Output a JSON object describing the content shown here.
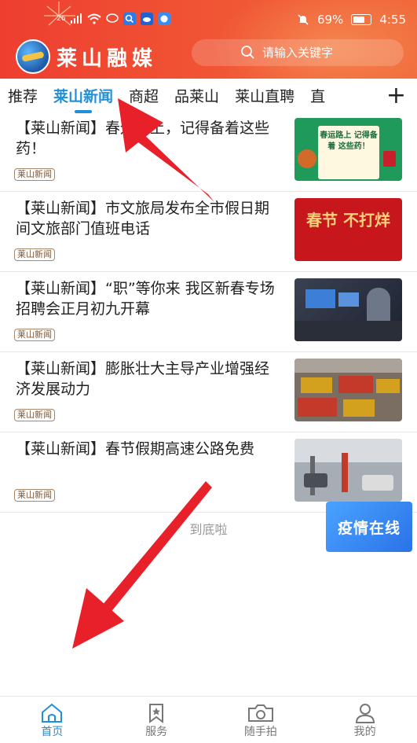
{
  "status": {
    "network_label": "26",
    "battery": "69%",
    "time": "4:55"
  },
  "header": {
    "app_name": "莱山融媒",
    "search_placeholder": "请输入关键字"
  },
  "tabs": [
    {
      "label": "推荐",
      "active": false
    },
    {
      "label": "莱山新闻",
      "active": true
    },
    {
      "label": "商超",
      "active": false
    },
    {
      "label": "品莱山",
      "active": false
    },
    {
      "label": "莱山直聘",
      "active": false
    },
    {
      "label": "直",
      "active": false
    }
  ],
  "tabs_add_label": "+",
  "news": [
    {
      "title": "【莱山新闻】春运路上，记得备着这些药！",
      "tag": "莱山新闻",
      "thumb_text": "春运路上 记得备着 这些药！"
    },
    {
      "title": "【莱山新闻】市文旅局发布全市假日期间文旅部门值班电话",
      "tag": "莱山新闻",
      "thumb_text": "春节 不打烊"
    },
    {
      "title": "【莱山新闻】“职”等你来 我区新春专场招聘会正月初九开幕",
      "tag": "莱山新闻",
      "thumb_text": ""
    },
    {
      "title": "【莱山新闻】膨胀壮大主导产业增强经济发展动力",
      "tag": "莱山新闻",
      "thumb_text": ""
    },
    {
      "title": "【莱山新闻】春节假期高速公路免费",
      "tag": "莱山新闻",
      "thumb_text": ""
    }
  ],
  "end_text": "到底啦",
  "float_button": "疫情在线",
  "bottom_nav": [
    {
      "label": "首页",
      "icon": "home-icon",
      "active": true
    },
    {
      "label": "服务",
      "icon": "bookmark-star-icon",
      "active": false
    },
    {
      "label": "随手拍",
      "icon": "camera-icon",
      "active": false
    },
    {
      "label": "我的",
      "icon": "user-icon",
      "active": false
    }
  ],
  "colors": {
    "header": "#ee3e30",
    "accent": "#1f8fd7",
    "arrow": "#e8202a"
  }
}
